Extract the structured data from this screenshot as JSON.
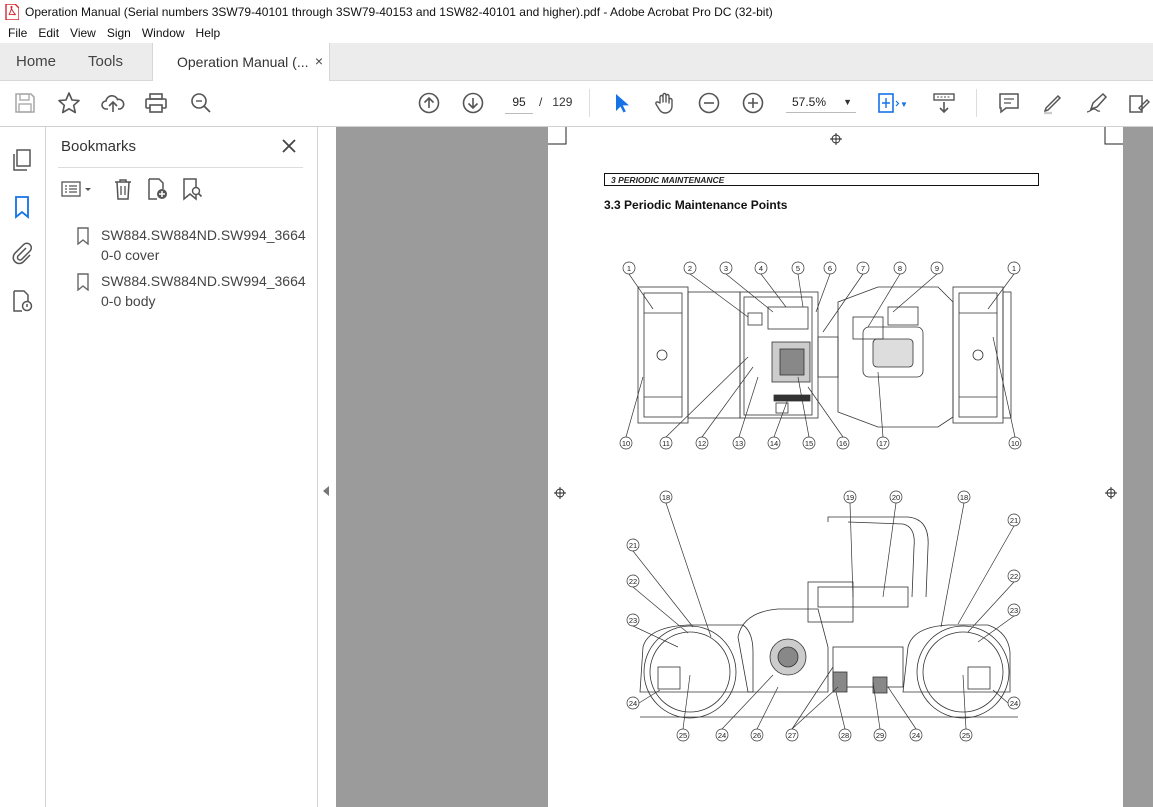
{
  "window": {
    "title": "Operation Manual (Serial numbers 3SW79-40101 through 3SW79-40153 and 1SW82-40101 and higher).pdf - Adobe Acrobat Pro DC (32-bit)"
  },
  "menu": [
    "File",
    "Edit",
    "View",
    "Sign",
    "Window",
    "Help"
  ],
  "tabs": {
    "home": "Home",
    "tools": "Tools",
    "doc": "Operation Manual (...",
    "close": "×"
  },
  "toolbar": {
    "page_current": "95",
    "page_sep": "/",
    "page_total": "129",
    "zoom": "57.5%"
  },
  "bookmarks": {
    "title": "Bookmarks",
    "items": [
      {
        "label": "SW884.SW884ND.SW994_36640-0 cover"
      },
      {
        "label": "SW884.SW884ND.SW994_36640-0 body"
      }
    ]
  },
  "document": {
    "section_box": "3   PERIODIC MAINTENANCE",
    "heading": "3.3  Periodic Maintenance Points",
    "top_callouts": [
      "1",
      "2",
      "3",
      "4",
      "5",
      "6",
      "7",
      "8",
      "9",
      "1",
      "10",
      "11",
      "12",
      "13",
      "14",
      "15",
      "16",
      "17",
      "10"
    ],
    "side_callouts": [
      "18",
      "19",
      "20",
      "18",
      "21",
      "21",
      "22",
      "22",
      "23",
      "23",
      "24",
      "24",
      "25",
      "24",
      "26",
      "27",
      "28",
      "29",
      "24",
      "25"
    ]
  },
  "colors": {
    "accent": "#1473e6",
    "viewer_bg": "#9b9b9b",
    "acrobat_red": "#d7282f"
  }
}
